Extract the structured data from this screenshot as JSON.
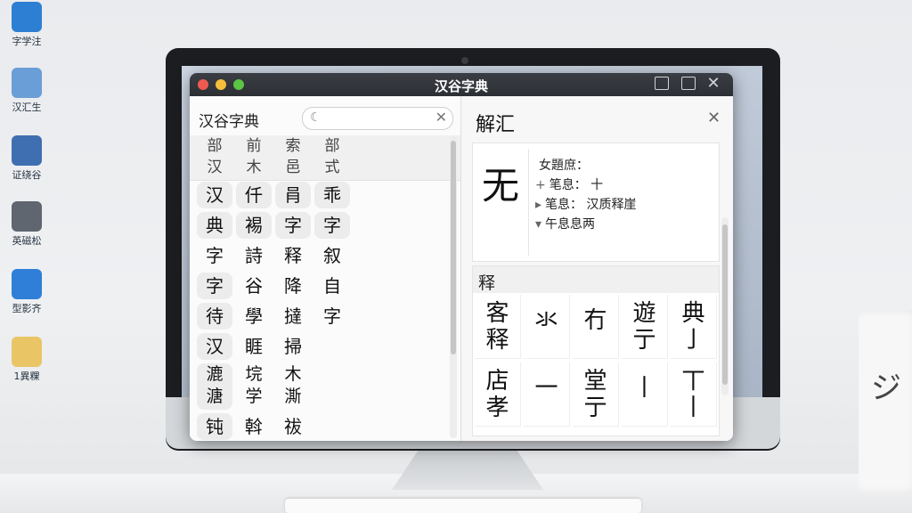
{
  "desktop": {
    "icons": [
      {
        "label": "字学注",
        "icon": "bird-app-icon",
        "color": "#2d7fd3"
      },
      {
        "label": "汉汇生",
        "icon": "cloud-user-icon",
        "color": "#6a9ed6"
      },
      {
        "label": "证绕谷",
        "icon": "document-window-icon",
        "color": "#3f6fb1"
      },
      {
        "label": "英磁松",
        "icon": "notebook-icon",
        "color": "#5f6670"
      },
      {
        "label": "型影齐",
        "icon": "document-pen-icon",
        "color": "#2f7fd8"
      },
      {
        "label": "1異粿",
        "icon": "folder-icon",
        "color": "#e9c565"
      }
    ]
  },
  "mug": {
    "text": "ジ"
  },
  "window": {
    "title": "汉谷字典",
    "left": {
      "app_title": "汉谷字典",
      "search": {
        "value": "",
        "placeholder": ""
      },
      "headers": [
        {
          "top": "部",
          "bottom": "汉"
        },
        {
          "top": "前",
          "bottom": "木"
        },
        {
          "top": "索",
          "bottom": "邑"
        },
        {
          "top": "部",
          "bottom": "式"
        }
      ],
      "grid": [
        [
          "汉",
          "仟",
          "肙",
          "乖"
        ],
        [
          "典",
          "裼",
          "字",
          "字"
        ],
        [
          "字",
          "詩",
          "释",
          "叙"
        ],
        [
          "字",
          "谷",
          "降",
          "自"
        ],
        [
          "待",
          "學",
          "撻",
          "字"
        ],
        [
          "汉",
          "睚",
          "掃",
          ""
        ],
        [
          "漉\n溏",
          "垸\n学",
          "木\n澌",
          ""
        ],
        [
          "钝",
          "斡",
          "祓",
          ""
        ]
      ]
    },
    "right": {
      "title": "解汇",
      "char": "无",
      "info": [
        {
          "marker": "",
          "text": "女題庶："
        },
        {
          "marker": "+",
          "text": "笔息：  十"
        },
        {
          "marker": "▸",
          "text": "笔息：  汉质释崖"
        },
        {
          "marker": "▾",
          "text": "午息息两"
        }
      ],
      "section_title": "释",
      "strokes_row1": [
        "客\n释",
        "氺",
        "冇",
        "遊\n亍",
        "典\n亅"
      ],
      "strokes_row2": [
        "店\n孝",
        "一",
        "堂\n亍",
        "丨",
        "丅\n丨"
      ]
    }
  }
}
